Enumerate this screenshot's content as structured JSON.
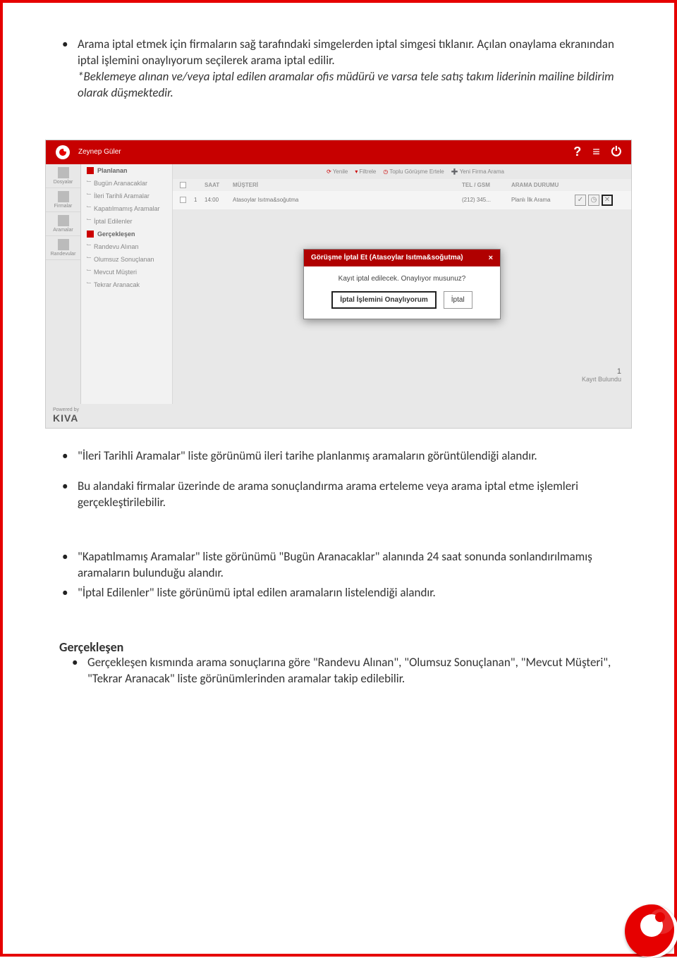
{
  "doc": {
    "para1_part1": "Arama iptal etmek için firmaların sağ tarafındaki simgelerden iptal simgesi tıklanır. Açılan onaylama ekranından iptal işlemini onaylıyorum seçilerek arama iptal edilir.",
    "para1_note": "*Beklemeye alınan ve/veya iptal edilen aramalar ofis müdürü ve varsa tele satış takım liderinin mailine bildirim olarak düşmektedir.",
    "bullet_ileri": "\"İleri Tarihli Aramalar\" liste görünümü ileri tarihe planlanmış aramaların görüntülendiği alandır.",
    "bullet_bu_alandaki": "Bu alandaki firmalar üzerinde de arama sonuçlandırma arama erteleme veya arama iptal etme işlemleri gerçekleştirilebilir.",
    "bullet_kapatilmamis": "\"Kapatılmamış Aramalar\" liste görünümü \"Bugün Aranacaklar\" alanında 24 saat sonunda sonlandırılmamış aramaların bulunduğu alandır.",
    "bullet_iptal_edilenler": "\"İptal Edilenler\" liste görünümü iptal edilen aramaların listelendiği alandır.",
    "heading_gerceklesen": "Gerçekleşen",
    "bullet_gerceklesen": "Gerçekleşen kısmında arama sonuçlarına göre \"Randevu Alınan\", \"Olumsuz Sonuçlanan\", \"Mevcut Müşteri\", \"Tekrar Aranacak\" liste görünümlerinden aramalar takip edilebilir."
  },
  "app": {
    "user_name": "Zeynep Güler",
    "sidebar": [
      {
        "label": "Dosyalar"
      },
      {
        "label": "Firmalar"
      },
      {
        "label": "Aramalar"
      },
      {
        "label": "Randevular"
      }
    ],
    "nav": {
      "section_planlanan": "Planlanan",
      "items_planlanan": [
        "Bugün Aranacaklar",
        "İleri Tarihli Aramalar",
        "Kapatılmamış Aramalar",
        "İptal Edilenler"
      ],
      "section_gerceklesen": "Gerçekleşen",
      "items_gerceklesen": [
        "Randevu Alınan",
        "Olumsuz Sonuçlanan",
        "Mevcut Müşteri",
        "Tekrar Aranacak"
      ]
    },
    "toolbar": {
      "yenile": "Yenile",
      "filtrele": "Filtrele",
      "toplu_ertele": "Toplu Görüşme Ertele",
      "yeni_firma": "Yeni Firma Arama"
    },
    "table": {
      "col_saat": "SAAT",
      "col_musteri": "MÜŞTERİ",
      "col_tel": "TEL / GSM",
      "col_durum": "ARAMA DURUMU",
      "row": {
        "idx": "1",
        "time": "14:00",
        "customer": "Atasoylar Isıtma&soğutma",
        "tel": "(212) 345...",
        "status": "Planlı İlk Arama"
      }
    },
    "modal": {
      "title": "Görüşme İptal Et (Atasoylar Isıtma&soğutma)",
      "message": "Kayıt iptal edilecek. Onaylıyor musunuz?",
      "btn_confirm": "İptal İşlemini Onaylıyorum",
      "btn_cancel": "İptal"
    },
    "footer": {
      "count_num": "1",
      "count_label": "Kayıt Bulundu",
      "powered_by": "Powered by",
      "brand": "KIVA"
    }
  }
}
